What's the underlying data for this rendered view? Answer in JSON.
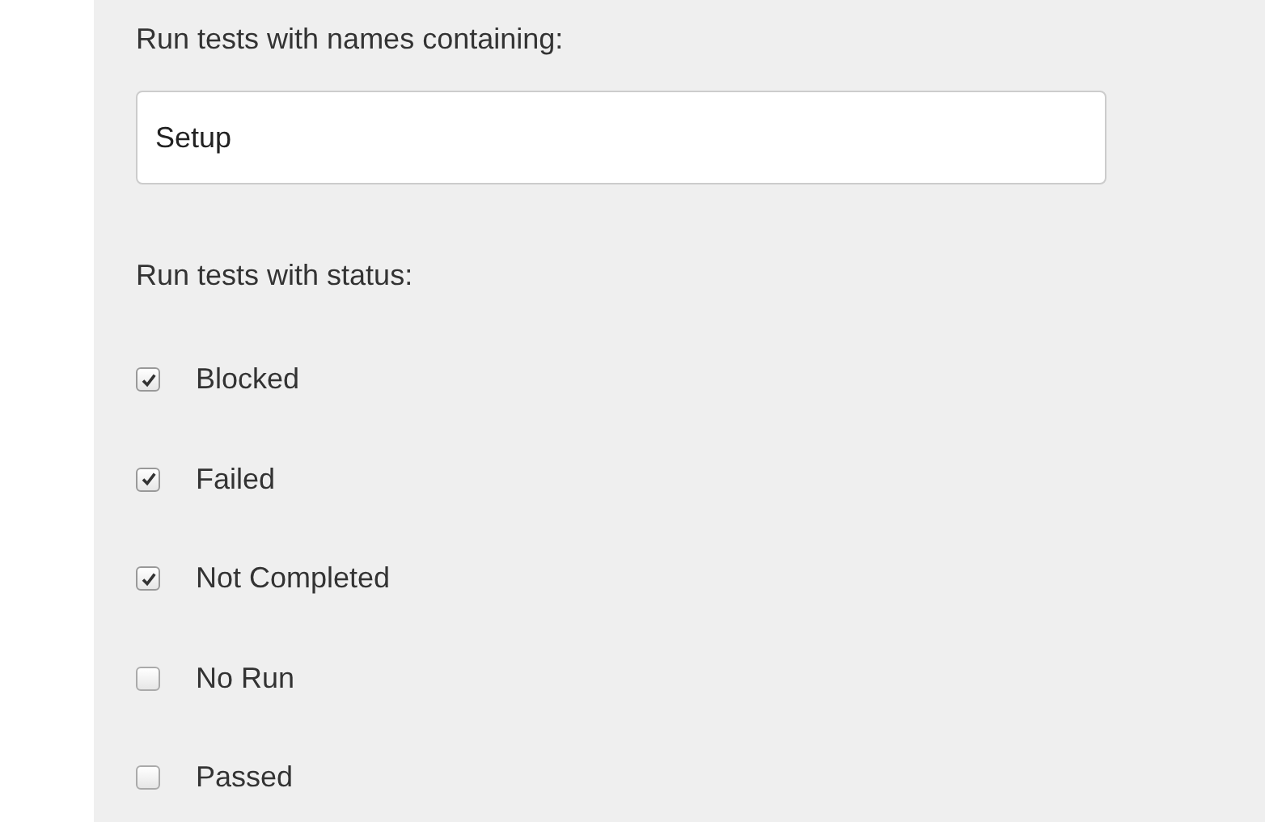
{
  "name_filter": {
    "label": "Run tests with names containing:",
    "value": "Setup"
  },
  "status_filter": {
    "label": "Run tests with status:",
    "options": [
      {
        "label": "Blocked",
        "checked": true
      },
      {
        "label": "Failed",
        "checked": true
      },
      {
        "label": "Not Completed",
        "checked": true
      },
      {
        "label": "No Run",
        "checked": false
      },
      {
        "label": "Passed",
        "checked": false
      }
    ]
  }
}
